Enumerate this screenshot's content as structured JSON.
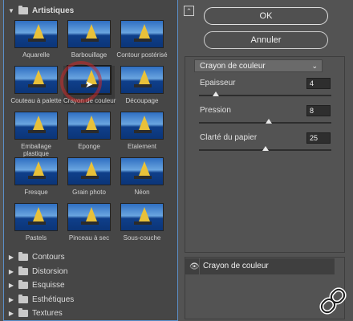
{
  "left": {
    "open_folder": "Artistiques",
    "thumbnails": [
      {
        "label": "Aquarelle"
      },
      {
        "label": "Barbouillage"
      },
      {
        "label": "Contour postérisé"
      },
      {
        "label": "Couteau à palette"
      },
      {
        "label": "Crayon de couleur"
      },
      {
        "label": "Découpage"
      },
      {
        "label": "Emballage\nplastique"
      },
      {
        "label": "Eponge"
      },
      {
        "label": "Etalement"
      },
      {
        "label": "Fresque"
      },
      {
        "label": "Grain photo"
      },
      {
        "label": "Néon"
      },
      {
        "label": "Pastels"
      },
      {
        "label": "Pinceau à sec"
      },
      {
        "label": "Sous-couche"
      }
    ],
    "folders": [
      {
        "label": "Contours"
      },
      {
        "label": "Distorsion"
      },
      {
        "label": "Esquisse"
      },
      {
        "label": "Esthétiques"
      },
      {
        "label": "Textures"
      }
    ]
  },
  "right": {
    "ok_label": "OK",
    "cancel_label": "Annuler",
    "filter_selected": "Crayon de couleur",
    "params": [
      {
        "label": "Epaisseur",
        "value": "4",
        "level": 0.13
      },
      {
        "label": "Pression",
        "value": "8",
        "level": 0.53
      },
      {
        "label": "Clarté du papier",
        "value": "25",
        "level": 0.5
      }
    ],
    "layer_name": "Crayon de couleur"
  }
}
